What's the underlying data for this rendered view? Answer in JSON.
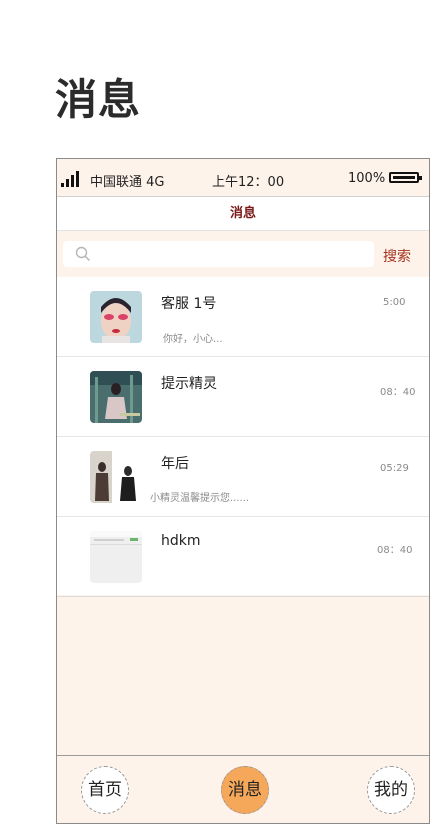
{
  "page": {
    "title": "消息"
  },
  "status_bar": {
    "carrier": "中国联通 4G",
    "time": "上午12：00",
    "battery": "100%"
  },
  "header": {
    "title": "消息"
  },
  "search": {
    "placeholder": "",
    "button_label": "搜索"
  },
  "conversations": [
    {
      "name": "客服 1号",
      "preview": "你好，小心...",
      "time": "5:00"
    },
    {
      "name": "提示精灵",
      "preview": "",
      "time": "08：40"
    },
    {
      "name": "年后",
      "preview": "小精灵温馨提示您......",
      "time": "05:29"
    },
    {
      "name": "hdkm",
      "preview": "",
      "time": "08：40"
    }
  ],
  "tabbar": {
    "home": "首页",
    "messages": "消息",
    "me": "我的"
  },
  "colors": {
    "background": "#fdf3ea",
    "accent": "#f6a85a",
    "header_title": "#7a1a1a",
    "search_button": "#a8321e"
  }
}
